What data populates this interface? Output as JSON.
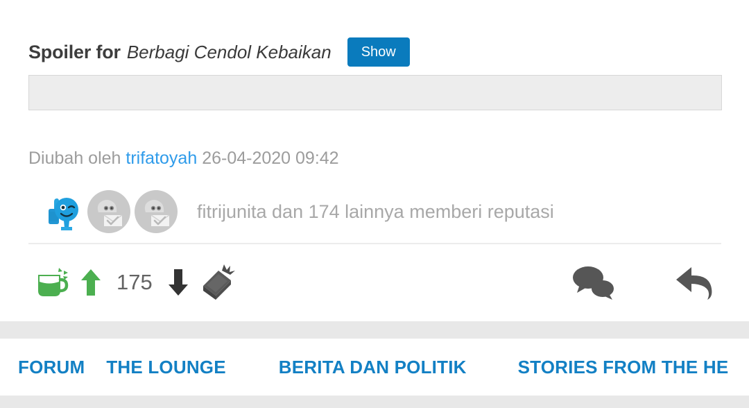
{
  "spoiler": {
    "label": "Spoiler for",
    "title": "Berbagi Cendol Kebaikan",
    "show_button": "Show",
    "body_placeholder": ""
  },
  "edited": {
    "prefix": "Diubah oleh",
    "username": "trifatoyah",
    "timestamp": "26-04-2020 09:42"
  },
  "reputation": {
    "text": "fitrijunita dan 174 lainnya memberi reputasi",
    "avatars": [
      {
        "name": "cendol-smiley-avatar",
        "type": "cendol"
      },
      {
        "name": "default-avatar-1",
        "type": "placeholder"
      },
      {
        "name": "default-avatar-2",
        "type": "placeholder"
      }
    ]
  },
  "actions": {
    "cendol_icon": "cendol-cup-icon",
    "upvote_icon": "arrow-up-icon",
    "vote_count": "175",
    "downvote_icon": "arrow-down-icon",
    "bata_icon": "brick-icon",
    "comment_icon": "comment-bubbles-icon",
    "reply_icon": "reply-arrow-icon"
  },
  "breadcrumb": {
    "items": [
      {
        "label": "FORUM"
      },
      {
        "label": "THE LOUNGE"
      },
      {
        "label": "BERITA DAN POLITIK"
      },
      {
        "label": "STORIES FROM THE HE"
      }
    ]
  },
  "colors": {
    "accent_blue": "#0a7bbd",
    "link_blue": "#2e9bea",
    "crumb_blue": "#1380c4",
    "cendol_green": "#4caf50",
    "icon_dark": "#555555",
    "muted_gray": "#a8a8a8",
    "band_gray": "#e8e8e8"
  }
}
